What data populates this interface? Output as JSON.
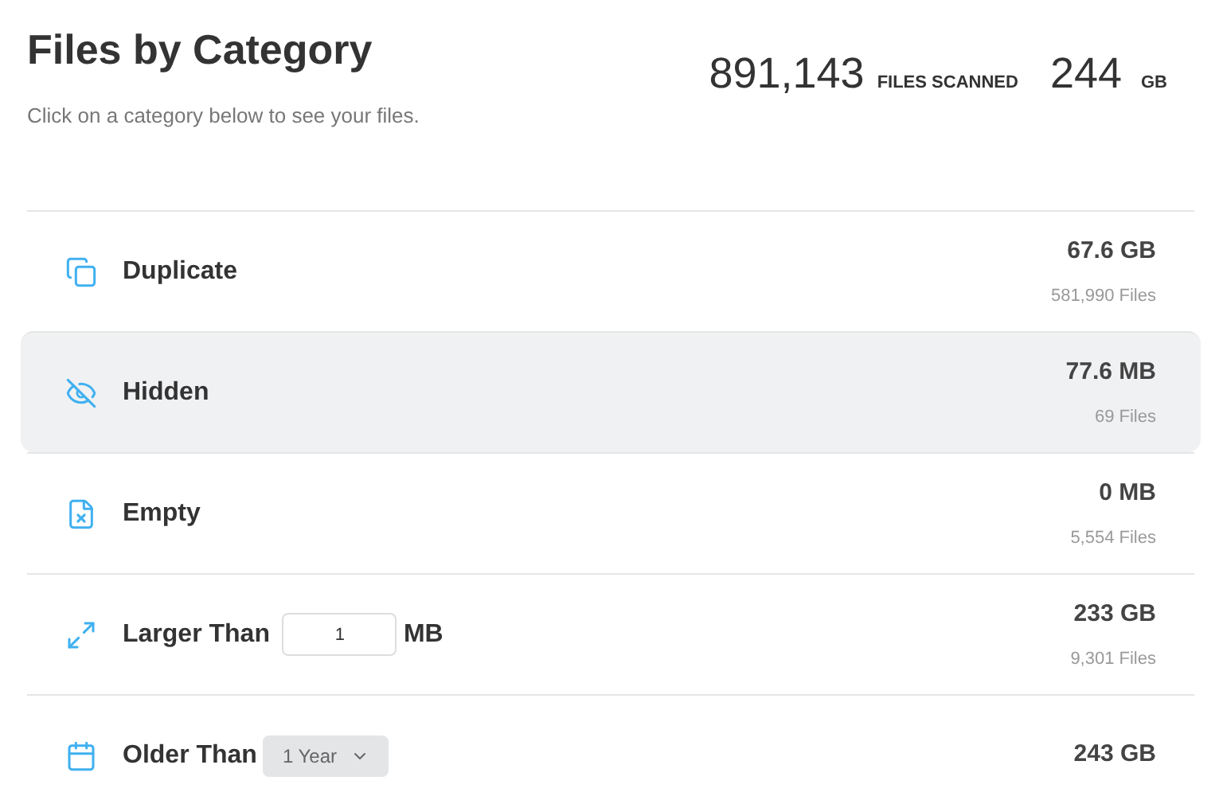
{
  "header": {
    "title": "Files by Category",
    "subtitle": "Click on a category below to see your files.",
    "files_count": "891,143",
    "files_label": "FILES SCANNED",
    "size": "244",
    "size_unit": "GB"
  },
  "categories": [
    {
      "kind": "duplicate",
      "label": "Duplicate",
      "size": "67.6 GB",
      "files": "581,990 Files",
      "selected": false
    },
    {
      "kind": "hidden",
      "label": "Hidden",
      "size": "77.6 MB",
      "files": "69 Files",
      "selected": true
    },
    {
      "kind": "empty",
      "label": "Empty",
      "size": "0 MB",
      "files": "5,554 Files",
      "selected": false
    },
    {
      "kind": "size_filter",
      "label": "Larger Than",
      "value": "1",
      "unit": "MB",
      "size": "233 GB",
      "files": "9,301 Files",
      "selected": false
    },
    {
      "kind": "age_filter",
      "label": "Older Than",
      "value": "1 Year",
      "size": "243 GB",
      "selected": false
    }
  ]
}
